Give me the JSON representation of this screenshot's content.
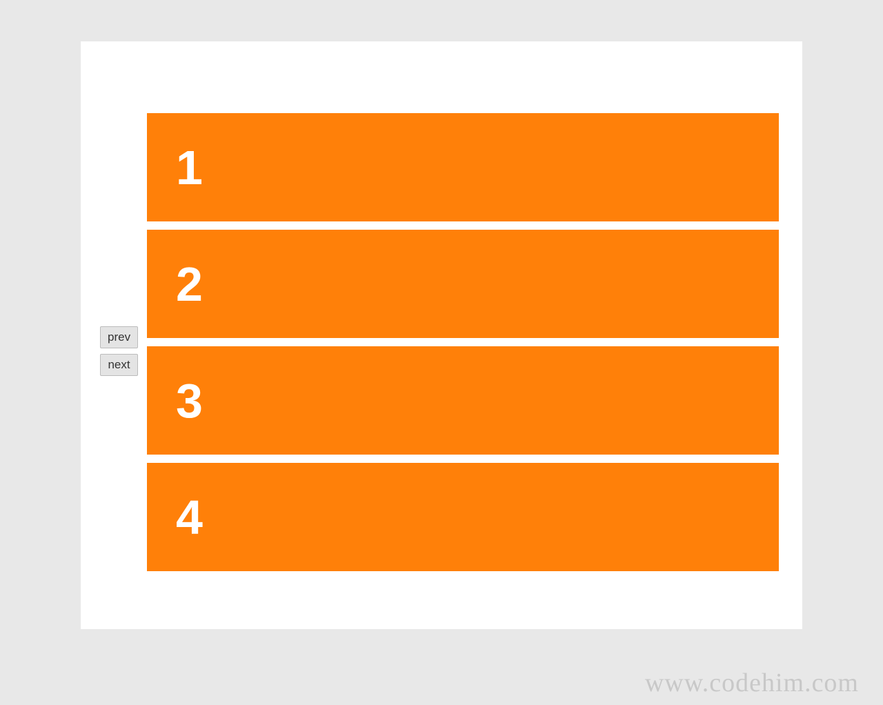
{
  "controls": {
    "prev_label": "prev",
    "next_label": "next"
  },
  "slides": [
    {
      "number": "1"
    },
    {
      "number": "2"
    },
    {
      "number": "3"
    },
    {
      "number": "4"
    }
  ],
  "watermark": "www.codehim.com",
  "colors": {
    "slide_bg": "#ff8009",
    "page_bg": "#e8e8e8",
    "container_bg": "#ffffff"
  }
}
